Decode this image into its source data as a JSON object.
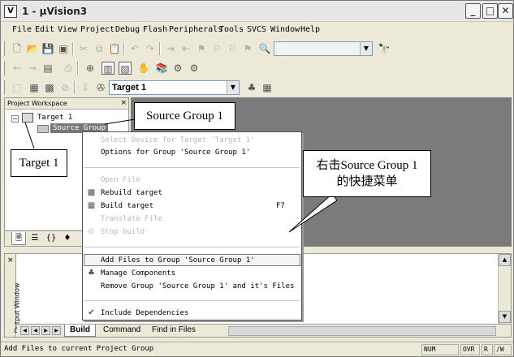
{
  "window": {
    "title": "1 - µVision3",
    "minimize": "_",
    "maximize": "□",
    "close": "✕"
  },
  "menu": [
    "File",
    "Edit",
    "View",
    "Project",
    "Debug",
    "Flash",
    "Peripherals",
    "Tools",
    "SVCS",
    "Window",
    "Help"
  ],
  "toolbar": {
    "target_combo": "Target 1"
  },
  "workspace": {
    "title": "Project Workspace",
    "close": "×",
    "expander": "−",
    "target": "Target 1",
    "group": "Source Group"
  },
  "context_menu": {
    "items": [
      {
        "label": "Select Device for Target 'Target 1'",
        "disabled": true
      },
      {
        "label": "Options for Group 'Source Group 1'",
        "disabled": false
      },
      {
        "label": "Open File",
        "disabled": true
      },
      {
        "label": "Rebuild target",
        "disabled": false
      },
      {
        "label": "Build target",
        "disabled": false,
        "shortcut": "F7"
      },
      {
        "label": "Translate File",
        "disabled": true
      },
      {
        "label": "Stop build",
        "disabled": true
      },
      {
        "label": "Add Files to Group 'Source Group 1'",
        "disabled": false,
        "highlighted": true
      },
      {
        "label": "Manage Components",
        "disabled": false
      },
      {
        "label": "Remove Group 'Source Group 1' and it's Files",
        "disabled": false
      },
      {
        "label": "Include Dependencies",
        "disabled": false,
        "checked": true
      }
    ]
  },
  "callouts": {
    "source_group": "Source Group 1",
    "target": "Target 1",
    "shortcut_line1": "右击Source Group 1",
    "shortcut_line2": "的快捷菜单"
  },
  "output": {
    "side_label": "Output Window",
    "close": "×",
    "tabs": [
      "Build",
      "Command",
      "Find in Files"
    ]
  },
  "status": {
    "text": "Add Files to current Project Group",
    "num": "NUM",
    "ovr": "OVR",
    "r": "R",
    "w": "/W"
  }
}
